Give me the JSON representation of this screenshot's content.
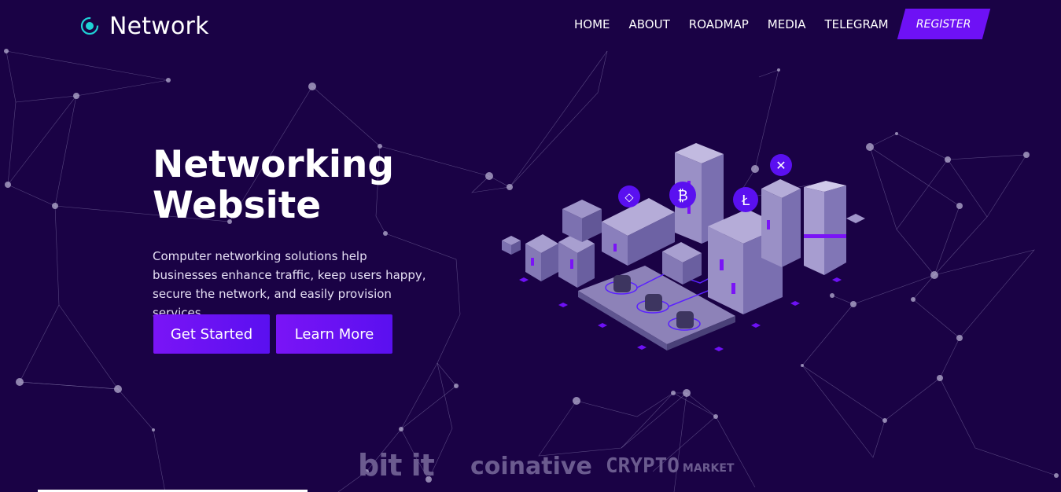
{
  "brand": {
    "name": "Network",
    "icon": "orbit-dot-icon",
    "accent": "#1fd1d6"
  },
  "nav": {
    "items": [
      "HOME",
      "ABOUT",
      "ROADMAP",
      "MEDIA",
      "TELEGRAM"
    ],
    "register_label": "REGISTER"
  },
  "hero": {
    "title_line1": "Networking",
    "title_line2": "Website",
    "description": "Computer networking solutions help businesses enhance traffic, keep users happy, secure the network, and easily provision services.",
    "primary_button": "Get Started",
    "secondary_button": "Learn More"
  },
  "illustration": {
    "description_icon": "isometric-crypto-city-icon",
    "coins": [
      "ethereum-icon",
      "bitcoin-icon",
      "litecoin-icon",
      "ripple-icon"
    ]
  },
  "partners": {
    "bitit": "bit it",
    "coinative": "coinative",
    "crypto": "CRYPTO",
    "market": "MARKET"
  },
  "colors": {
    "background": "#1a0245",
    "button": "#6e11f5",
    "partner_text": "#6b5b8f"
  }
}
